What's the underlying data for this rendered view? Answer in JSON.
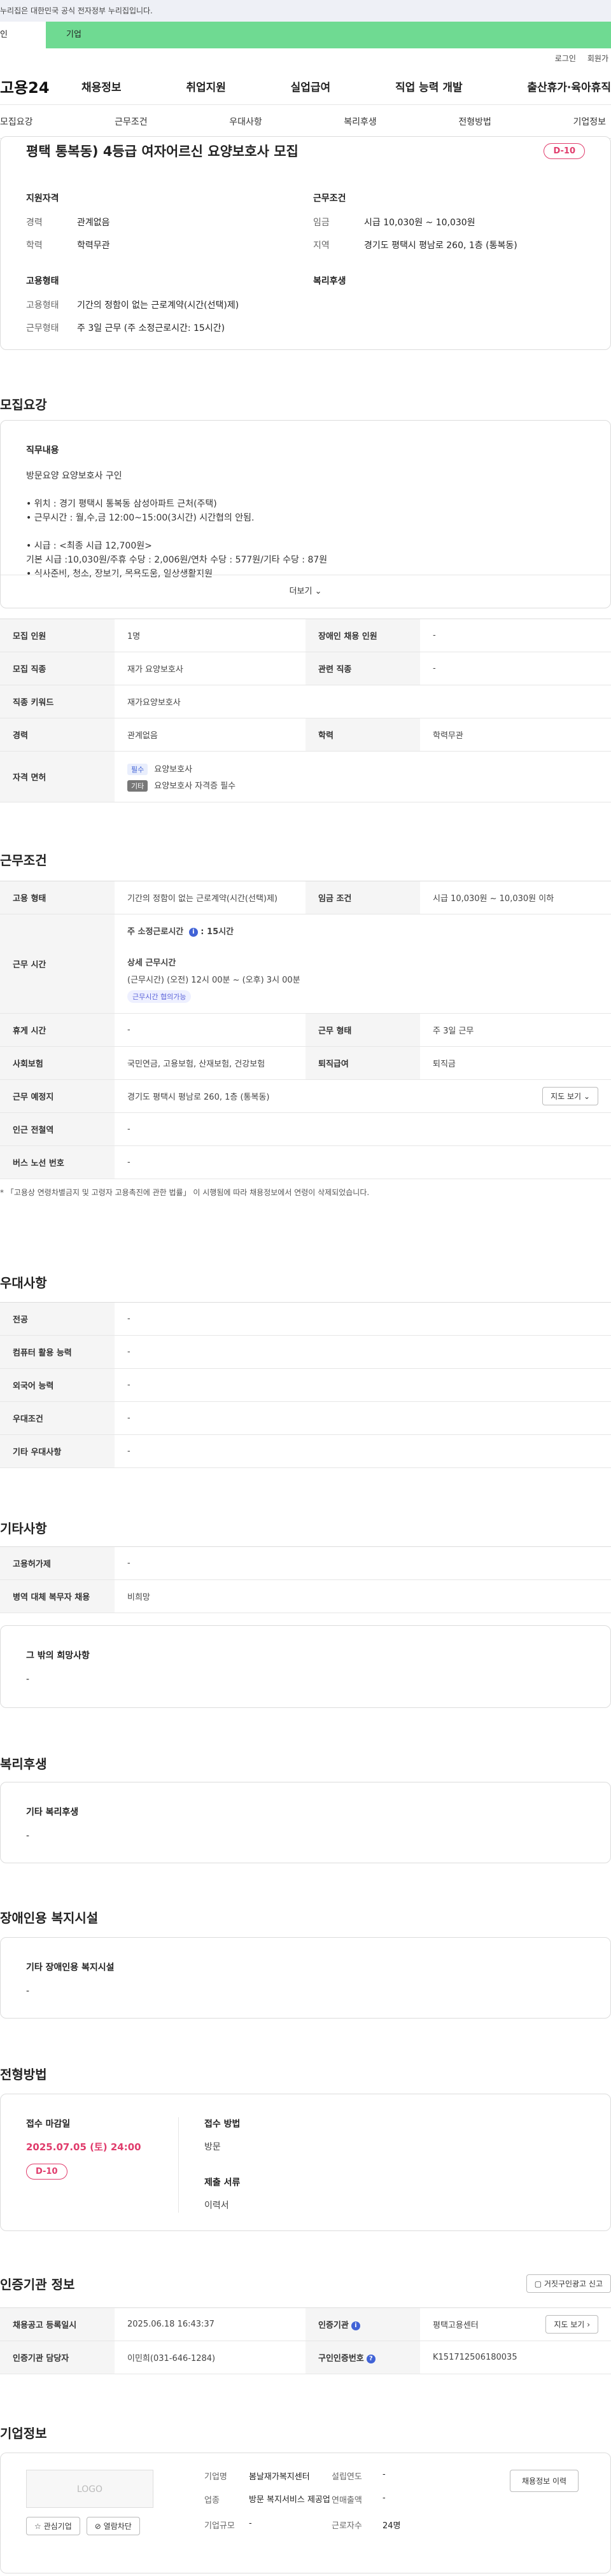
{
  "gov_notice": "누리집은 대한민국 공식 전자정부 누리집입니다.",
  "user_tabs": {
    "personal": "인",
    "company": "기업"
  },
  "util": {
    "login": "로그인",
    "join": "회원가"
  },
  "logo": "고용24",
  "gnb": [
    "채용정보",
    "취업지원",
    "실업급여",
    "직업 능력 개발",
    "출산휴가·육아휴직"
  ],
  "subnav": [
    "모집요강",
    "근무조건",
    "우대사항",
    "복리후생",
    "전형방법",
    "기업정보"
  ],
  "summary": {
    "title": "평택 통복동) 4등급 여자어르신 요양보호사 모집",
    "dday": "D-10",
    "qual_title": "지원자격",
    "qual": [
      {
        "k": "경력",
        "v": "관계없음"
      },
      {
        "k": "학력",
        "v": "학력무관"
      }
    ],
    "cond_title": "근무조건",
    "cond": [
      {
        "k": "임금",
        "v": "시급 10,030원 ~ 10,030원"
      },
      {
        "k": "지역",
        "v": "경기도 평택시 평남로 260, 1층 (통복동)"
      }
    ],
    "emp_title": "고용형태",
    "emp": [
      {
        "k": "고용형태",
        "v": "기간의 정함이 없는 근로계약(시간(선택)제)"
      },
      {
        "k": "근무형태",
        "v": "주 3일 근무 (주 소정근로시간: 15시간)"
      }
    ],
    "welfare_title": "복리후생"
  },
  "recruit": {
    "section_title": "모집요강",
    "job_title": "직무내용",
    "job_text": "방문요양 요양보호사 구인\n\n• 위치 : 경기 평택시 통복동 삼성아파트 근처(주택)\n• 근무시간 : 월,수,금 12:00~15:00(3시간) 시간협의 안됨.\n\n• 시급 :  <최종 시급 12,700원>\n         기본 시급 :10,030원/주휴 수당 : 2,006원/연차 수당 : 577원/기타 수당 : 87원\n• 식사준비, 청소, 장보기, 목욕도움, 일상생활지원",
    "more": "더보기",
    "rows": {
      "count_k": "모집 인원",
      "count_v": "1명",
      "disabled_k": "장애인 채용 인원",
      "disabled_v": "-",
      "job_k": "모집 직종",
      "job_v": "재가 요양보호사",
      "related_k": "관련 직종",
      "related_v": "-",
      "kw_k": "직종 키워드",
      "kw_v": "재가요양보호사",
      "career_k": "경력",
      "career_v": "관계없음",
      "edu_k": "학력",
      "edu_v": "학력무관",
      "license_k": "자격 면허",
      "license_tag1": "필수",
      "license_v1": "요양보호사",
      "license_tag2": "기타",
      "license_v2": "요양보호사 자격증 필수"
    }
  },
  "work": {
    "section_title": "근무조건",
    "emp_k": "고용 형태",
    "emp_v": "기간의 정함이 없는 근로계약(시간(선택)제)",
    "wage_k": "임금 조건",
    "wage_v": "시급 10,030원 ~ 10,030원 이하",
    "hours_k": "근무 시간",
    "hours_line1": "주 소정근로시간",
    "hours_line1_v": "15시간",
    "hours_detail_title": "상세 근무시간",
    "hours_detail": "(근무시간) (오전) 12시 00분 ~ (오후) 3시 00분",
    "hours_chip": "근무시간 협의가능",
    "rest_k": "휴게 시간",
    "rest_v": "-",
    "type_k": "근무 형태",
    "type_v": "주 3일 근무",
    "ins_k": "사회보험",
    "ins_v": "국민연금, 고용보험, 산재보험, 건강보험",
    "ret_k": "퇴직급여",
    "ret_v": "퇴직금",
    "place_k": "근무 예정지",
    "place_v": "경기도 평택시 평남로 260, 1층 (통복동)",
    "map_btn": "지도 보기",
    "station_k": "인근 전철역",
    "station_v": "-",
    "bus_k": "버스 노선 번호",
    "bus_v": "-",
    "note": "* 「고용상 연령차별금지 및 고령자 고용촉진에 관한 법률」 이 시행됨에 따라 채용정보에서 연령이 삭제되었습니다."
  },
  "pref": {
    "section_title": "우대사항",
    "rows": [
      {
        "k": "전공",
        "v": "-"
      },
      {
        "k": "컴퓨터 활용 능력",
        "v": "-"
      },
      {
        "k": "외국어 능력",
        "v": "-"
      },
      {
        "k": "우대조건",
        "v": "-"
      },
      {
        "k": "기타 우대사항",
        "v": "-"
      }
    ]
  },
  "etc": {
    "section_title": "기타사항",
    "rows": [
      {
        "k": "고용허가제",
        "v": "-"
      },
      {
        "k": "병역 대체 복무자 채용",
        "v": "비희망"
      }
    ],
    "other_title": "그 밖의 희망사항",
    "other_v": "-"
  },
  "welfare": {
    "section_title": "복리후생",
    "title": "기타 복리후생",
    "v": "-"
  },
  "disabled": {
    "section_title": "장애인용 복지시설",
    "title": "기타 장애인용 복지시설",
    "v": "-"
  },
  "process": {
    "section_title": "전형방법",
    "deadline_title": "접수 마감일",
    "deadline_v": "2025.07.05 (토) 24:00",
    "dday": "D-10",
    "method_title": "접수 방법",
    "method_v": "방문",
    "docs_title": "제출 서류",
    "docs_v": "이력서"
  },
  "cert": {
    "section_title": "인증기관 정보",
    "report_btn": "거짓구인광고 신고",
    "reg_k": "채용공고 등록일시",
    "reg_v": "2025.06.18 16:43:37",
    "agency_k": "인증기관",
    "agency_v": "평택고용센터",
    "map_btn": "지도 보기",
    "mgr_k": "인증기관 담당자",
    "mgr_v": "이민희(031-646-1284)",
    "no_k": "구인인증번호",
    "no_v": "K151712506180035"
  },
  "company": {
    "section_title": "기업정보",
    "logo": "LOGO",
    "fav_btn": "관심기업",
    "block_btn": "열람차단",
    "name_k": "기업명",
    "name_v": "봄날재가복지센터",
    "year_k": "설립연도",
    "year_v": "-",
    "industry_k": "업종",
    "industry_v": "방문 복지서비스 제공업",
    "sales_k": "연매출액",
    "sales_v": "-",
    "emp_k": "근로자수",
    "emp_v": "24명",
    "size_k": "기업규모",
    "size_v": "-",
    "jobs_btn": "채용정보 이력"
  }
}
